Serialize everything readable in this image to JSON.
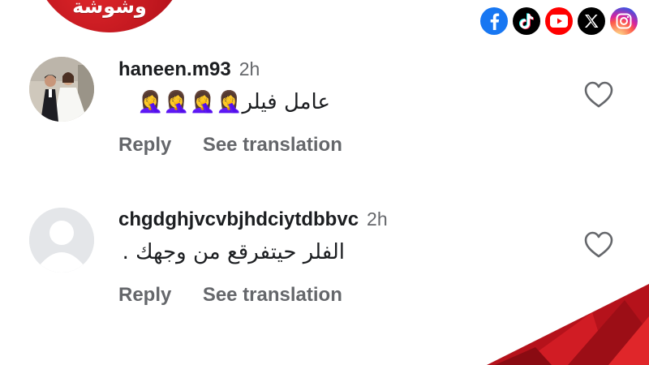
{
  "brand": {
    "name": "وشوشة",
    "color": "#c41a22"
  },
  "social_icons": [
    {
      "name": "facebook-icon",
      "color": "#1877f2"
    },
    {
      "name": "tiktok-icon",
      "color": "#000000"
    },
    {
      "name": "youtube-icon",
      "color": "#ff0000"
    },
    {
      "name": "x-icon",
      "color": "#000000"
    },
    {
      "name": "instagram-icon",
      "color": "#d6249f"
    }
  ],
  "comments": [
    {
      "username": "haneen.m93",
      "time": "2h",
      "text": "عامل فيلر🤦‍♀️🤦‍♀️🤦‍♀️🤦‍♀️",
      "avatar": "wedding-photo",
      "actions": {
        "reply": "Reply",
        "translate": "See translation"
      },
      "liked": false
    },
    {
      "username": "chgdghjvcvbjhdciytdbbvc",
      "time": "2h",
      "text": "الفلر حيتفرقع من وجهك .",
      "avatar": "default-avatar",
      "actions": {
        "reply": "Reply",
        "translate": "See translation"
      },
      "liked": false
    }
  ],
  "colors": {
    "text": "#1c1e21",
    "muted": "#65676b",
    "accent": "#c41a22"
  }
}
